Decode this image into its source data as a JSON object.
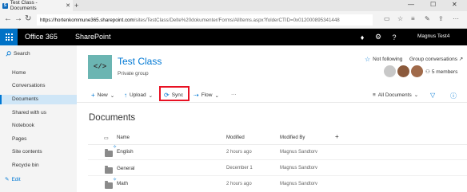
{
  "browser": {
    "tab_title": "Test Class - Documents",
    "url_host": "https://hortenkommune365.sharepoint.com",
    "url_path": "/sites/TestClass/Delte%20dokumenter/Forms/AllItems.aspx?folderCTID=0x012000895341448"
  },
  "suite": {
    "app_name": "Office 365",
    "product": "SharePoint",
    "user_name": "Magnus Test4",
    "accent_color": "#0072c6"
  },
  "leftnav": {
    "search_label": "Search",
    "items": [
      "Home",
      "Conversations",
      "Documents",
      "Shared with us",
      "Notebook",
      "Pages",
      "Site contents",
      "Recycle bin"
    ],
    "active": "Documents",
    "edit_label": "Edit"
  },
  "site": {
    "logo_glyph": "</>",
    "title": "Test Class",
    "subtitle": "Private group",
    "follow_label": "Not following",
    "group_conv_label": "Group conversations ↗",
    "members_label": "5 members"
  },
  "commands": {
    "new_label": "New",
    "upload_label": "Upload",
    "sync_label": "Sync",
    "flow_label": "Flow",
    "more_label": "···",
    "view_label": "All Documents",
    "highlight_color": "#e81123"
  },
  "library": {
    "title": "Documents",
    "columns": [
      "Name",
      "Modified",
      "Modified By"
    ],
    "add_column_label": "+",
    "rows": [
      {
        "name": "English",
        "modified": "2 hours ago",
        "modified_by": "Magnus Sandtorv"
      },
      {
        "name": "General",
        "modified": "December 1",
        "modified_by": "Magnus Sandtorv"
      },
      {
        "name": "Math",
        "modified": "2 hours ago",
        "modified_by": "Magnus Sandtorv"
      }
    ]
  }
}
